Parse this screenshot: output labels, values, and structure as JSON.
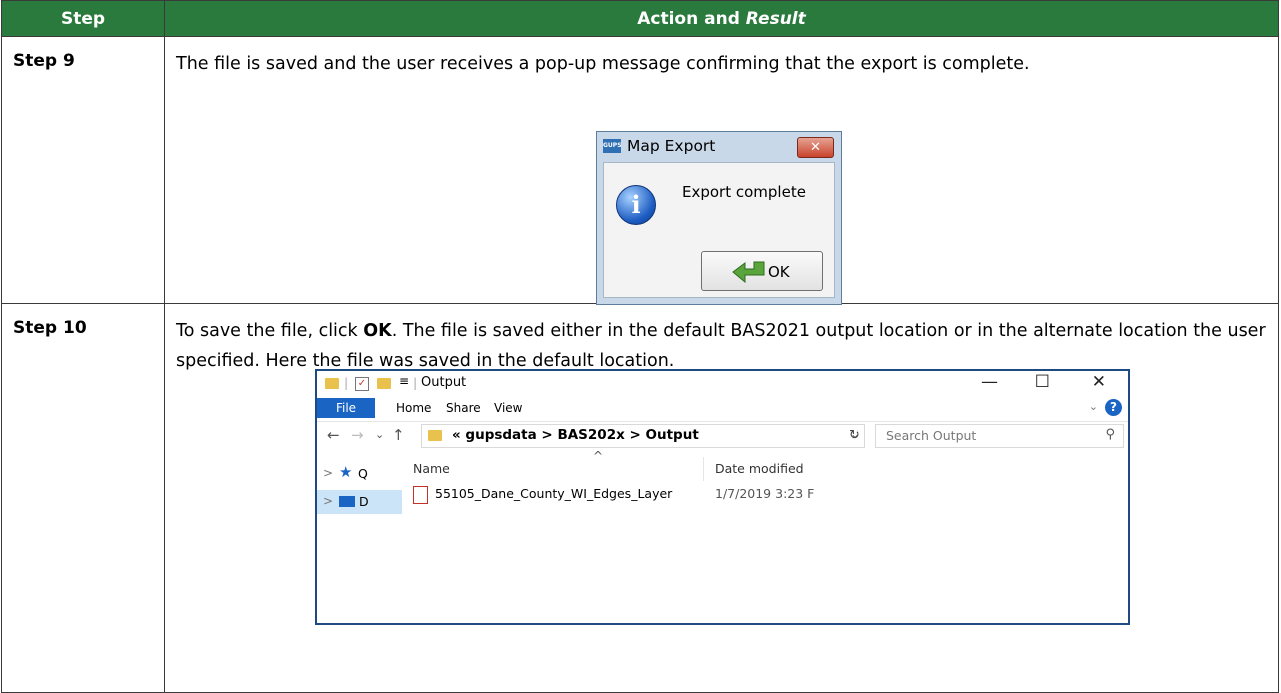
{
  "header": {
    "step": "Step",
    "action": "Action and ",
    "result": "Result"
  },
  "rows": [
    {
      "step": "Step 9",
      "text": "The file is saved and the user receives a pop-up message confirming that the export is complete."
    },
    {
      "step": "Step 10",
      "text_pre": "To save the file, click ",
      "text_bold": "OK",
      "text_post": ". The file is saved either in the default BAS2021 output location or in the alternate location the user specified. Here the file was saved in the default location."
    }
  ],
  "dialog": {
    "app_icon": "GUPS",
    "title": "Map Export",
    "message": "Export complete",
    "ok_label": "OK",
    "close_glyph": "✕"
  },
  "explorer": {
    "title": "Output",
    "ribbon": {
      "file": "File",
      "home": "Home",
      "share": "Share",
      "view": "View"
    },
    "address": "« gupsdata > BAS202x > Output",
    "search_placeholder": "Search Output",
    "nav": {
      "quick": "Q",
      "desktop": "D"
    },
    "columns": {
      "name": "Name",
      "date": "Date modified"
    },
    "files": [
      {
        "name": "55105_Dane_County_WI_Edges_Layer",
        "date": "1/7/2019 3:23 F"
      }
    ]
  },
  "colors": {
    "header_green": "#2a7a3d",
    "file_blue": "#1a64c4",
    "folder_yellow": "#e9c24e"
  }
}
